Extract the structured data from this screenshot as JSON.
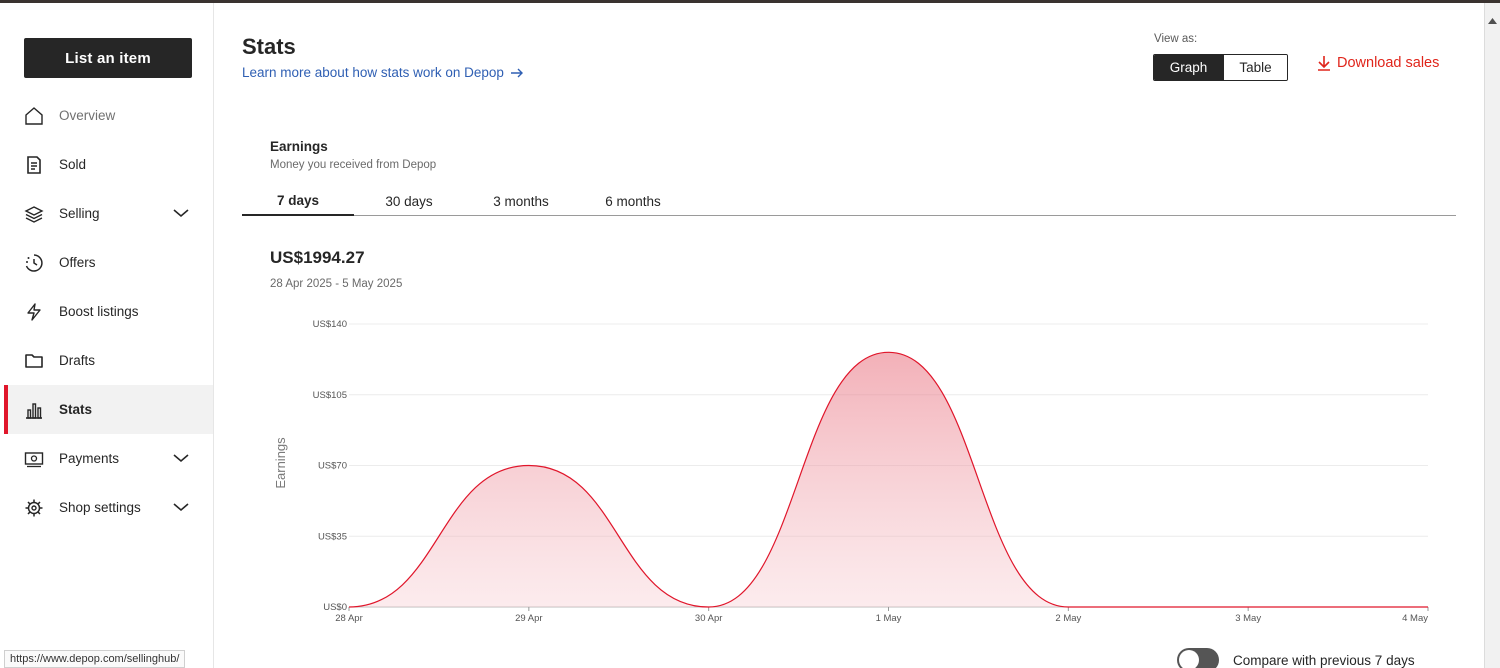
{
  "sidebar": {
    "list_button": "List an item",
    "items": [
      {
        "label": "Overview",
        "icon": "home-icon"
      },
      {
        "label": "Sold",
        "icon": "receipt-icon"
      },
      {
        "label": "Selling",
        "icon": "layers-icon"
      },
      {
        "label": "Offers",
        "icon": "offers-clock-icon"
      },
      {
        "label": "Boost listings",
        "icon": "lightning-icon"
      },
      {
        "label": "Drafts",
        "icon": "folder-icon"
      },
      {
        "label": "Stats",
        "icon": "bar-chart-icon"
      },
      {
        "label": "Payments",
        "icon": "banknote-icon"
      },
      {
        "label": "Shop settings",
        "icon": "gear-icon"
      }
    ],
    "active_item": "Stats"
  },
  "header": {
    "title": "Stats",
    "learn_link": "Learn more about how stats work on Depop",
    "view_as_label": "View as:",
    "view_options": [
      "Graph",
      "Table"
    ],
    "selected_view": "Graph",
    "download_label": "Download sales"
  },
  "earnings": {
    "title": "Earnings",
    "subtitle": "Money you received from Depop",
    "tabs": [
      "7 days",
      "30 days",
      "3 months",
      "6 months"
    ],
    "selected_tab": "7 days",
    "total": "US$1994.27",
    "date_range": "28 Apr 2025 - 5 May 2025"
  },
  "chart_data": {
    "type": "area",
    "ylabel": "Earnings",
    "ylim": [
      0,
      140
    ],
    "y_ticks": [
      "US$0",
      "US$35",
      "US$70",
      "US$105",
      "US$140"
    ],
    "categories": [
      "28 Apr",
      "29 Apr",
      "30 Apr",
      "1 May",
      "2 May",
      "3 May",
      "4 May"
    ],
    "values": [
      0,
      70,
      0,
      126,
      0,
      0,
      0
    ],
    "grid": true,
    "color": "#e0162b"
  },
  "compare": {
    "label": "Compare with previous 7 days",
    "enabled": false
  },
  "status_url": "https://www.depop.com/sellinghub/"
}
